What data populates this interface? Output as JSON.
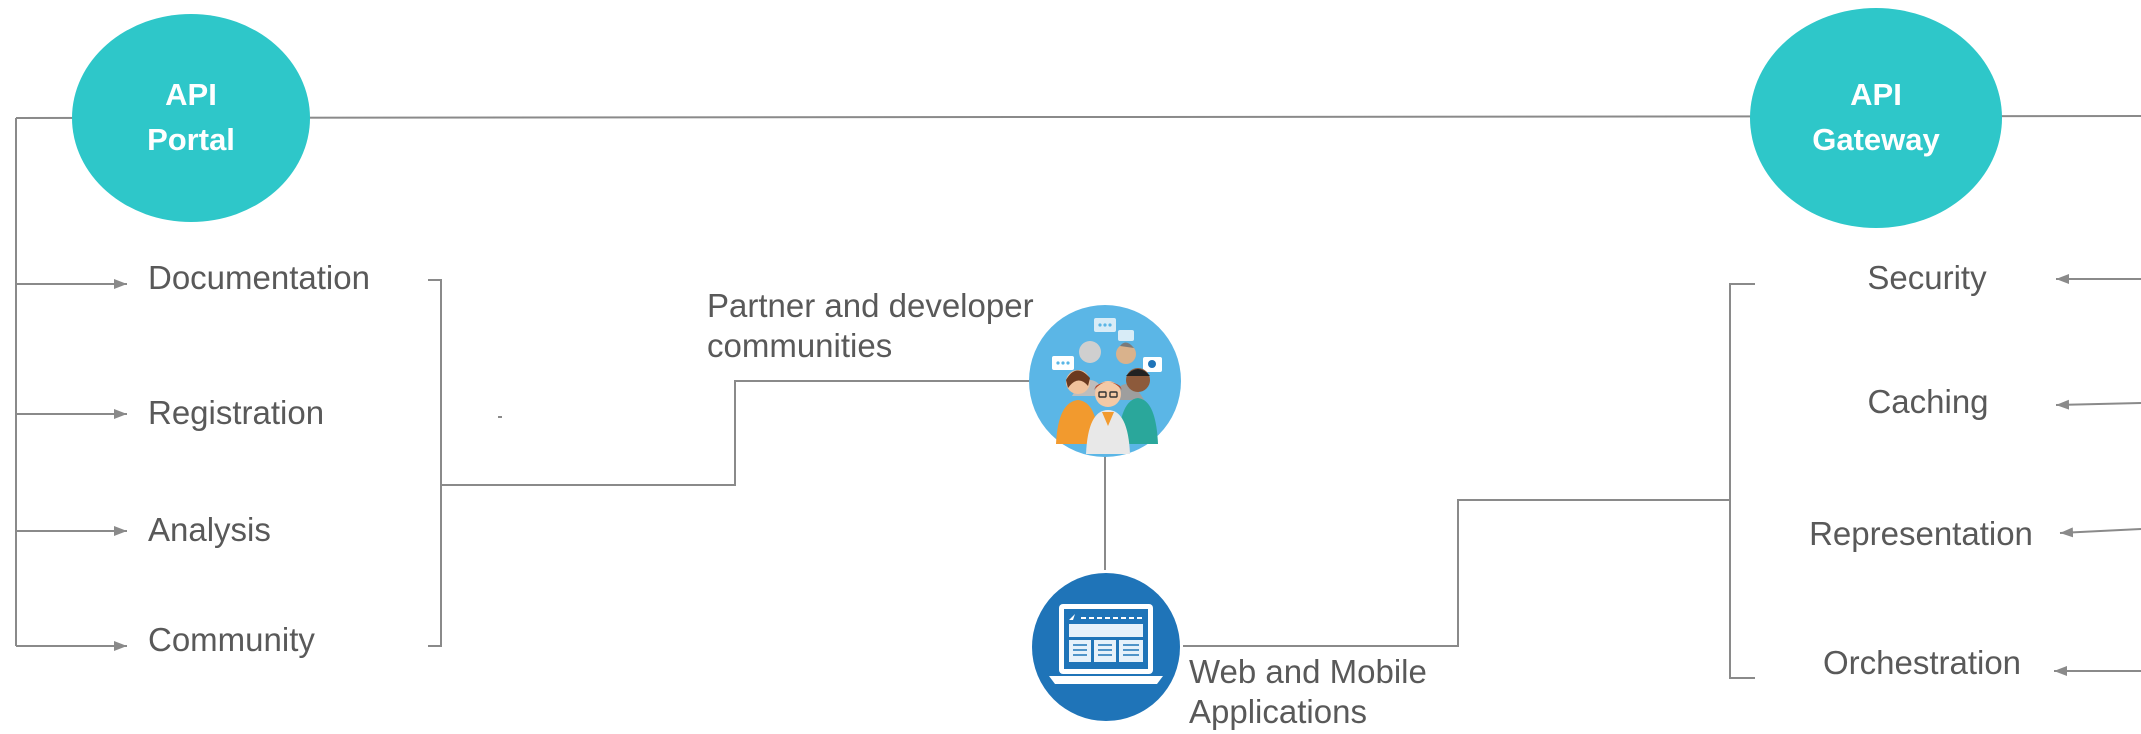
{
  "portal": {
    "title_line1": "API",
    "title_line2": "Portal",
    "items": [
      "Documentation",
      "Registration",
      "Analysis",
      "Community"
    ]
  },
  "gateway": {
    "title_line1": "API",
    "title_line2": "Gateway",
    "items": [
      "Security",
      "Caching",
      "Representation",
      "Orchestration"
    ]
  },
  "communities": {
    "line1": "Partner and developer",
    "line2": "communities",
    "icon": "people-group-icon"
  },
  "apps": {
    "line1": "Web and Mobile",
    "line2": "Applications",
    "icon": "laptop-app-icon"
  },
  "colors": {
    "node": "#2ec7c9",
    "connector": "#8a8a8a",
    "text": "#595959",
    "icon_bg_light": "#5bb6e6",
    "icon_bg_dark": "#1f74b8"
  }
}
